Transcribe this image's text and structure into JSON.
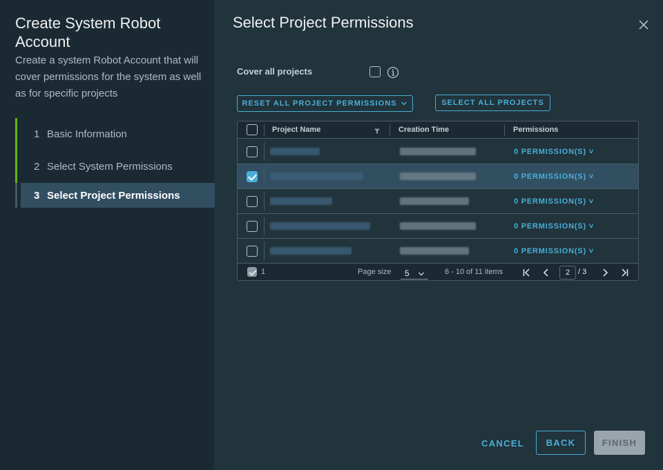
{
  "wizard": {
    "title": "Create System Robot Account",
    "description": "Create a system Robot Account that will cover permissions for the system as well as for specific projects",
    "steps": [
      {
        "num": "1",
        "label": "Basic Information"
      },
      {
        "num": "2",
        "label": "Select System Permissions"
      },
      {
        "num": "3",
        "label": "Select Project Permissions"
      }
    ]
  },
  "page": {
    "title": "Select Project Permissions",
    "cover_all_label": "Cover all projects",
    "reset_button": "RESET ALL PROJECT PERMISSIONS",
    "select_all_button": "SELECT ALL PROJECTS"
  },
  "grid": {
    "columns": [
      "Project Name",
      "Creation Time",
      "Permissions"
    ],
    "rows": [
      {
        "permission": "0 PERMISSION(S)",
        "selected": false
      },
      {
        "permission": "0 PERMISSION(S)",
        "selected": true
      },
      {
        "permission": "0 PERMISSION(S)",
        "selected": false
      },
      {
        "permission": "0 PERMISSION(S)",
        "selected": false
      },
      {
        "permission": "0 PERMISSION(S)",
        "selected": false
      }
    ],
    "footer": {
      "selected_count": "1",
      "page_size_label": "Page size",
      "page_size": "5",
      "range": "6 - 10 of 11 items",
      "current_page": "2",
      "total_pages": "/ 3"
    }
  },
  "actions": {
    "cancel": "CANCEL",
    "back": "BACK",
    "finish": "FINISH"
  },
  "colors": {
    "accent": "#49afd9",
    "step_complete": "#60b515",
    "selected_row": "#324f62"
  }
}
